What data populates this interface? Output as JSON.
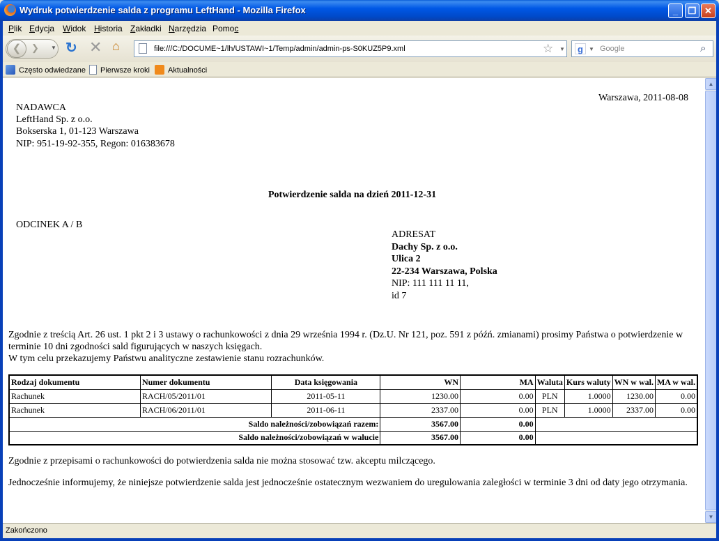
{
  "window": {
    "title": "Wydruk potwierdzenie salda z programu LeftHand - Mozilla Firefox",
    "minimize": "_",
    "maximize": "❐",
    "close": "✕"
  },
  "menu": {
    "items": [
      {
        "pre": "",
        "u": "P",
        "post": "lik"
      },
      {
        "pre": "",
        "u": "E",
        "post": "dycja"
      },
      {
        "pre": "",
        "u": "W",
        "post": "idok"
      },
      {
        "pre": "",
        "u": "H",
        "post": "istoria"
      },
      {
        "pre": "",
        "u": "Z",
        "post": "akładki"
      },
      {
        "pre": "",
        "u": "N",
        "post": "arzędzia"
      },
      {
        "pre": "Pomo",
        "u": "c",
        "post": ""
      }
    ]
  },
  "nav": {
    "url": "file:///C:/DOCUME~1/lh/USTAWI~1/Temp/admin/admin-ps-S0KUZ5P9.xml",
    "search_placeholder": "Google"
  },
  "bookmarks": [
    {
      "label": "Często odwiedzane",
      "icon": "often-visited-icon"
    },
    {
      "label": "Pierwsze kroki",
      "icon": "page-icon"
    },
    {
      "label": "Aktualności",
      "icon": "rss-icon"
    }
  ],
  "doc": {
    "place_date": "Warszawa, 2011-08-08",
    "sender": {
      "heading": "NADAWCA",
      "name": "LeftHand Sp. z o.o.",
      "address": "Bokserska 1, 01-123 Warszawa",
      "ids": "NIP: 951-19-92-355, Regon: 016383678"
    },
    "title": "Potwierdzenie salda na dzień 2011-12-31",
    "section": "ODCINEK A / B",
    "addressee": {
      "heading": "ADRESAT",
      "name": "Dachy Sp. z o.o.",
      "street": "Ulica 2",
      "city": "22-234 Warszawa, Polska",
      "nip": "NIP: 111 111 11 11,",
      "id": "id 7"
    },
    "intro": "Zgodnie z treścią Art. 26 ust. 1 pkt 2 i 3 ustawy o rachunkowości z dnia 29 września 1994 r. (Dz.U. Nr 121, poz. 591 z późń. zmianami) prosimy Państwa o potwierdzenie w terminie 10 dni zgodności sald figurujących w naszych księgach.",
    "intro2": "W tym celu przekazujemy Państwu analityczne zestawienie stanu rozrachunków.",
    "table": {
      "headers": [
        "Rodzaj dokumentu",
        "Numer dokumentu",
        "Data księgowania",
        "WN",
        "MA",
        "Waluta",
        "Kurs waluty",
        "WN w wal.",
        "MA w wal."
      ],
      "rows": [
        [
          "Rachunek",
          "RACH/05/2011/01",
          "2011-05-11",
          "1230.00",
          "0.00",
          "PLN",
          "1.0000",
          "1230.00",
          "0.00"
        ],
        [
          "Rachunek",
          "RACH/06/2011/01",
          "2011-06-11",
          "2337.00",
          "0.00",
          "PLN",
          "1.0000",
          "2337.00",
          "0.00"
        ]
      ],
      "total_label": "Saldo należności/zobowiązań razem:",
      "total_wn": "3567.00",
      "total_ma": "0.00",
      "total_cur_label": "Saldo należności/zobowiązań w walucie",
      "total_cur_wn": "3567.00",
      "total_cur_ma": "0.00"
    },
    "note1": "Zgodnie z przepisami o rachunkowości do potwierdzenia salda nie można stosować tzw. akceptu milczącego.",
    "note2": "Jednocześnie informujemy, że niniejsze potwierdzenie salda jest jednocześnie ostatecznym wezwaniem do uregulowania zaległości w terminie 3 dni od daty jego otrzymania."
  },
  "status": "Zakończono"
}
